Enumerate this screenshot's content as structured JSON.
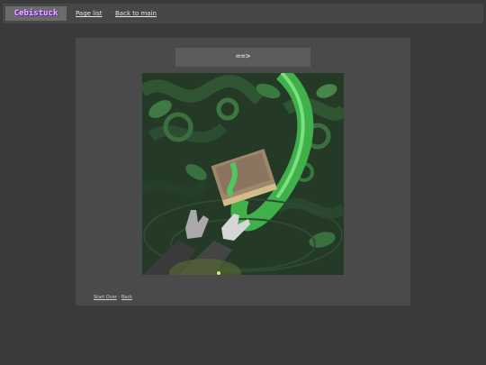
{
  "header": {
    "logo_text": "Cebistuck",
    "page_list_label": "Page list",
    "separator": "·",
    "back_to_main_label": "Back to main"
  },
  "panel": {
    "next_command": "==>",
    "image_description_icon": "comic-panel-image"
  },
  "footer": {
    "start_over_label": "Start Over",
    "separator": "-",
    "back_label": "Back"
  },
  "colors": {
    "page_bg": "#3a3a3a",
    "bar_bg": "#474747",
    "panel_bg": "#4a4a4a",
    "button_bg": "#5c5c5c",
    "logo_purple": "#e3b6ff"
  }
}
